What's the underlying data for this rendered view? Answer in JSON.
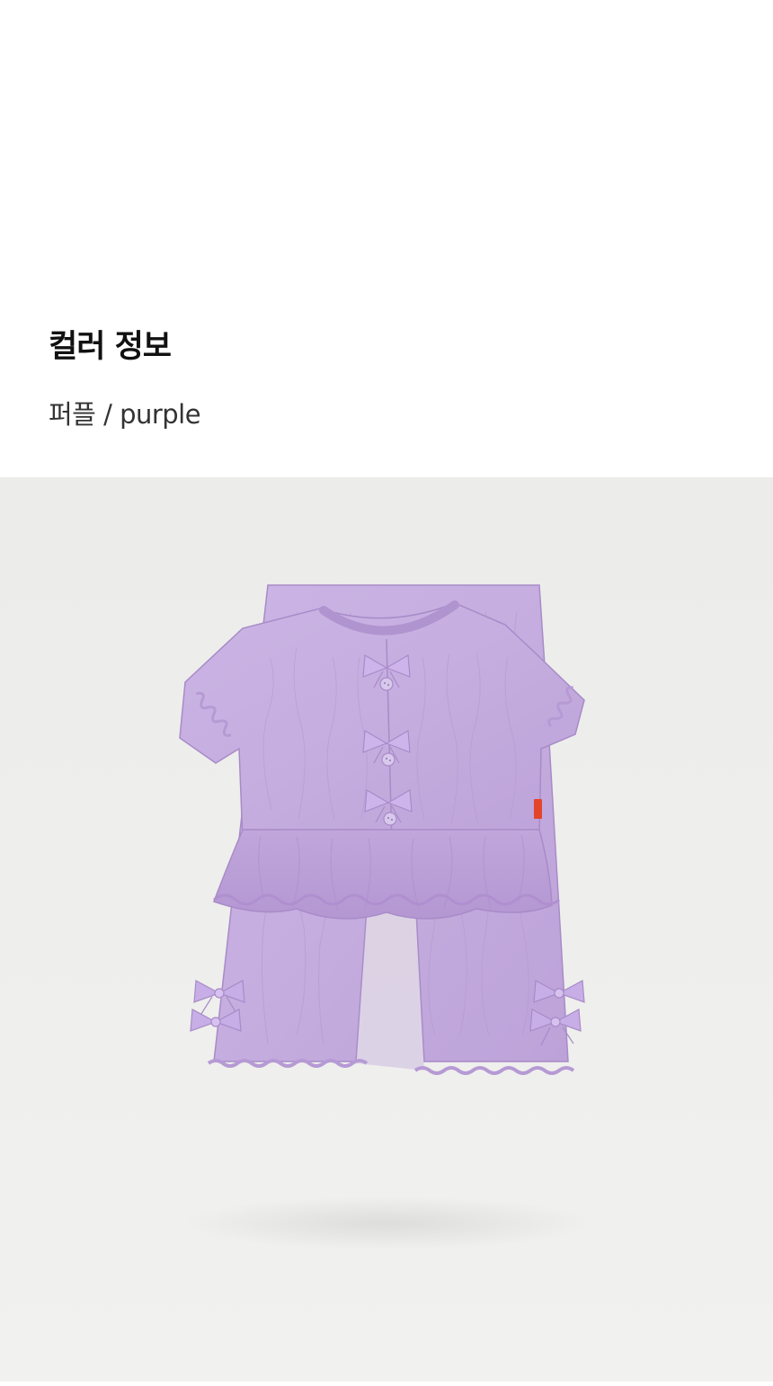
{
  "section": {
    "title": "컬러 정보",
    "color_label": "퍼플 / purple"
  },
  "photo": {
    "subject": "purple-two-piece-outfit",
    "background_color": "#eeeeec",
    "garment_color": "#c8b1e2"
  }
}
